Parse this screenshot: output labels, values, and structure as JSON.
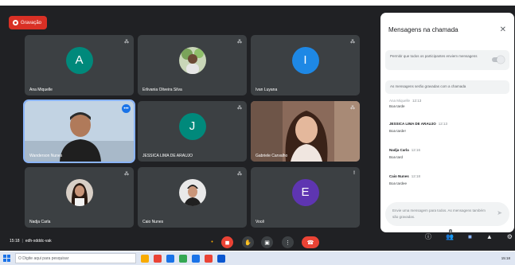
{
  "recording": {
    "label": "Gravação"
  },
  "tiles": [
    {
      "name": "Ana Miquelle",
      "initial": "A",
      "color": "#00897b",
      "kind": "avatar"
    },
    {
      "name": "Erlivania Oliveira Silva",
      "kind": "photo"
    },
    {
      "name": "Ivan Luyana",
      "initial": "I",
      "color": "#1e88e5",
      "kind": "avatar"
    },
    {
      "name": "Wanderson Nunes",
      "kind": "video"
    },
    {
      "name": "JESSICA LIMA DE ARAUJO",
      "initial": "J",
      "color": "#00897b",
      "kind": "avatar"
    },
    {
      "name": "Gabriele Carvalho",
      "kind": "video"
    },
    {
      "name": "Nadja Carla",
      "kind": "photo"
    },
    {
      "name": "Caio Nunes",
      "kind": "photo"
    },
    {
      "name": "Você",
      "initial": "E",
      "color": "#5e35b1",
      "kind": "avatar"
    }
  ],
  "panel": {
    "title": "Mensagens na chamada",
    "toggle_text": "Permitir que todos os participantes enviem mensagens",
    "notice": "As mensagens serão gravadas com a chamada",
    "messages": [
      {
        "sender": "Ana Miquelle",
        "time": "12:13",
        "text": "Boa tarde"
      },
      {
        "sender": "JESSICA LIMA DE ARAUJO",
        "time": "12:13",
        "text": "Boa tarde!"
      },
      {
        "sender": "Nadja Carla",
        "time": "12:16",
        "text": "Boa tard"
      },
      {
        "sender": "Caio Nunes",
        "time": "12:18",
        "text": "Boa tardee"
      }
    ],
    "composer_placeholder": "Envie uma mensagem para todos. As mensagens também são gravadas."
  },
  "meeting": {
    "time": "15:18",
    "code": "edh-xdddc-vak"
  },
  "participants_count": "9",
  "taskbar": {
    "search_placeholder": "O Digite aqui para pesquisar",
    "time": "15:18"
  }
}
